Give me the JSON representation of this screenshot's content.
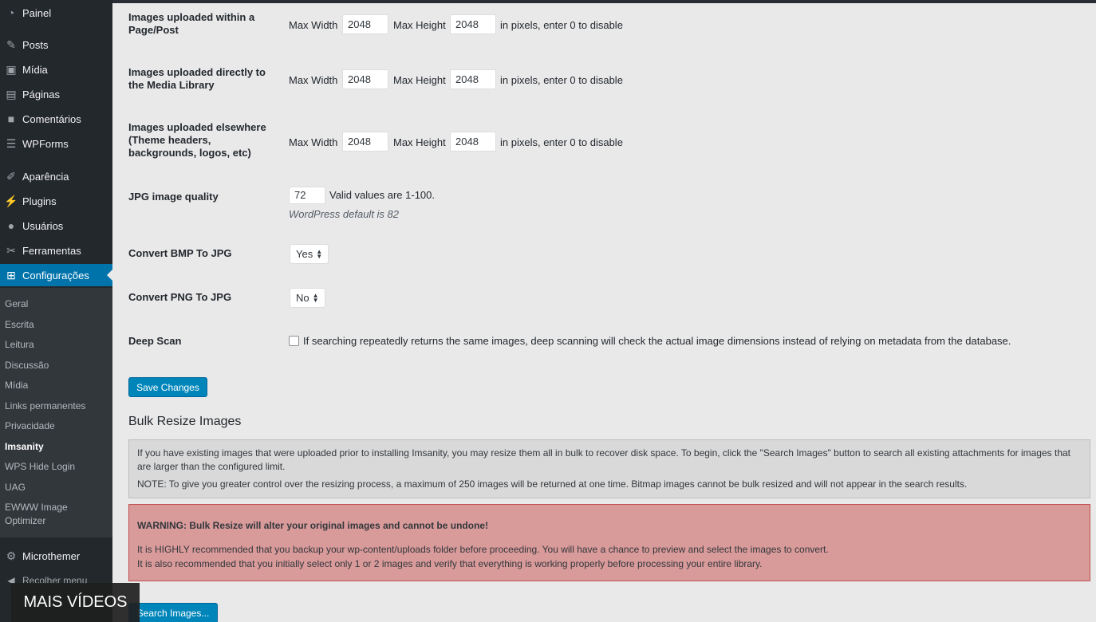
{
  "sidebar": {
    "items": [
      {
        "label": "Painel",
        "icon": "dashboard-icon"
      },
      {
        "label": "Posts",
        "icon": "pin-icon"
      },
      {
        "label": "Mídia",
        "icon": "media-icon"
      },
      {
        "label": "Páginas",
        "icon": "pages-icon"
      },
      {
        "label": "Comentários",
        "icon": "comment-icon"
      },
      {
        "label": "WPForms",
        "icon": "forms-icon"
      },
      {
        "label": "Aparência",
        "icon": "brush-icon"
      },
      {
        "label": "Plugins",
        "icon": "plugin-icon"
      },
      {
        "label": "Usuários",
        "icon": "user-icon"
      },
      {
        "label": "Ferramentas",
        "icon": "wrench-icon"
      },
      {
        "label": "Configurações",
        "icon": "settings-icon"
      }
    ],
    "submenu": [
      "Geral",
      "Escrita",
      "Leitura",
      "Discussão",
      "Mídia",
      "Links permanentes",
      "Privacidade",
      "Imsanity",
      "WPS Hide Login",
      "UAG",
      "EWWW Image",
      "Optimizer"
    ],
    "microthemer": "Microthemer",
    "collapse": "Recolher menu"
  },
  "settings": {
    "rows": [
      {
        "label": "Images uploaded within a Page/Post",
        "max_width_label": "Max Width",
        "max_width": "2048",
        "max_height_label": "Max Height",
        "max_height": "2048",
        "hint": "in pixels, enter 0 to disable"
      },
      {
        "label": "Images uploaded directly to the Media Library",
        "max_width_label": "Max Width",
        "max_width": "2048",
        "max_height_label": "Max Height",
        "max_height": "2048",
        "hint": "in pixels, enter 0 to disable"
      },
      {
        "label": "Images uploaded elsewhere (Theme headers, backgrounds, logos, etc)",
        "max_width_label": "Max Width",
        "max_width": "2048",
        "max_height_label": "Max Height",
        "max_height": "2048",
        "hint": "in pixels, enter 0 to disable"
      }
    ],
    "jpg_quality": {
      "label": "JPG image quality",
      "value": "72",
      "hint": "Valid values are 1-100.",
      "default_note": "WordPress default is 82"
    },
    "convert_bmp": {
      "label": "Convert BMP To JPG",
      "value": "Yes"
    },
    "convert_png": {
      "label": "Convert PNG To JPG",
      "value": "No"
    },
    "deep_scan": {
      "label": "Deep Scan",
      "checked": false,
      "description": "If searching repeatedly returns the same images, deep scanning will check the actual image dimensions instead of relying on metadata from the database."
    },
    "save_button": "Save Changes"
  },
  "bulk": {
    "title": "Bulk Resize Images",
    "notice_1": "If you have existing images that were uploaded prior to installing Imsanity, you may resize them all in bulk to recover disk space. To begin, click the \"Search Images\" button to search all existing attachments for images that are larger than the configured limit.",
    "notice_2": "NOTE: To give you greater control over the resizing process, a maximum of 250 images will be returned at one time. Bitmap images cannot be bulk resized and will not appear in the search results.",
    "warning_title": "WARNING: Bulk Resize will alter your original images and cannot be undone!",
    "warning_1": "It is HIGHLY recommended that you backup your wp-content/uploads folder before proceeding. You will have a chance to preview and select the images to convert.",
    "warning_2": "It is also recommended that you initially select only 1 or 2 images and verify that everything is working properly before processing your entire library.",
    "search_button": "Search Images..."
  },
  "overlay": {
    "label": "MAIS VÍDEOS"
  }
}
